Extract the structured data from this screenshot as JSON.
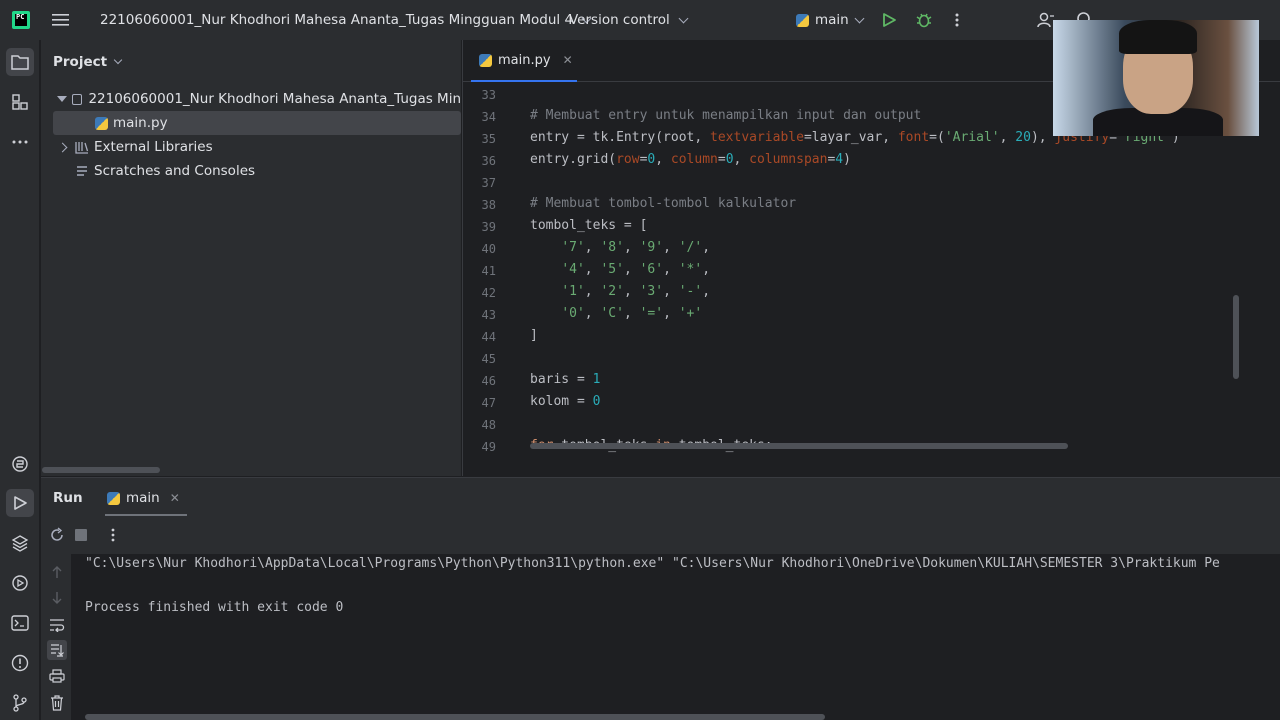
{
  "titlebar": {
    "logo_text": "PC",
    "project_name": "22106060001_Nur Khodhori Mahesa Ananta_Tugas Mingguan Modul 4",
    "vcs_label": "Version control",
    "run_config": "main"
  },
  "project_panel": {
    "header": "Project",
    "tree": [
      {
        "label": "22106060001_Nur Khodhori Mahesa Ananta_Tugas Min"
      },
      {
        "label": "main.py"
      },
      {
        "label": "External Libraries"
      },
      {
        "label": "Scratches and Consoles"
      }
    ]
  },
  "editor": {
    "tab_label": "main.py",
    "line_numbers": [
      "33",
      "34",
      "35",
      "36",
      "37",
      "38",
      "39",
      "40",
      "41",
      "42",
      "43",
      "44",
      "45",
      "46",
      "47",
      "48",
      "49"
    ],
    "lines": [
      "",
      "# Membuat entry untuk menampilkan input dan output",
      "entry = tk.Entry(root, textvariable=layar_var, font=('Arial', 20), justify='right')",
      "entry.grid(row=0, column=0, columnspan=4)",
      "",
      "# Membuat tombol-tombol kalkulator",
      "tombol_teks = [",
      "    '7', '8', '9', '/',",
      "    '4', '5', '6', '*',",
      "    '1', '2', '3', '-',",
      "    '0', 'C', '=', '+'",
      "]",
      "",
      "baris = 1",
      "kolom = 0",
      "",
      "for tombol_teks in tombol_teks:"
    ]
  },
  "run_panel": {
    "title": "Run",
    "tab_label": "main",
    "console_lines": [
      "\"C:\\Users\\Nur Khodhori\\AppData\\Local\\Programs\\Python\\Python311\\python.exe\" \"C:\\Users\\Nur Khodhori\\OneDrive\\Dokumen\\KULIAH\\SEMESTER 3\\Praktikum Pe",
      "",
      "Process finished with exit code 0"
    ]
  },
  "colors": {
    "background": "#1e1f22",
    "panel": "#2b2d30",
    "accent": "#3574f0",
    "run_green": "#5fb865",
    "comment": "#7a7e85",
    "string": "#6aab73",
    "number": "#2aacb8",
    "keyword": "#cf8e6d",
    "kwarg": "#aa4926"
  }
}
